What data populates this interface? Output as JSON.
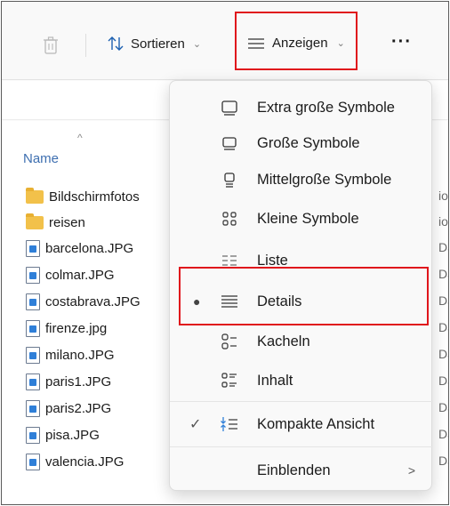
{
  "toolbar": {
    "delete_icon": "trash-icon",
    "sort_label": "Sortieren",
    "view_label": "Anzeigen",
    "more_label": "···"
  },
  "list": {
    "column_name": "Name",
    "files": [
      {
        "name": "Bildschirmfotos",
        "type": "folder",
        "right": "io"
      },
      {
        "name": "reisen",
        "type": "folder",
        "right": "io"
      },
      {
        "name": "barcelona.JPG",
        "type": "image",
        "right": "Da"
      },
      {
        "name": "colmar.JPG",
        "type": "image",
        "right": "Da"
      },
      {
        "name": "costabrava.JPG",
        "type": "image",
        "right": "Da"
      },
      {
        "name": "firenze.jpg",
        "type": "image",
        "right": "Da"
      },
      {
        "name": "milano.JPG",
        "type": "image",
        "right": "Da"
      },
      {
        "name": "paris1.JPG",
        "type": "image",
        "right": "Da"
      },
      {
        "name": "paris2.JPG",
        "type": "image",
        "right": "Da"
      },
      {
        "name": "pisa.JPG",
        "type": "image",
        "right": "Da"
      },
      {
        "name": "valencia.JPG",
        "type": "image",
        "right": "Da"
      }
    ]
  },
  "view_menu": {
    "items": [
      {
        "label": "Extra große Symbole",
        "icon": "extra-large-icons-icon"
      },
      {
        "label": "Große Symbole",
        "icon": "large-icons-icon"
      },
      {
        "label": "Mittelgroße Symbole",
        "icon": "medium-icons-icon"
      },
      {
        "label": "Kleine Symbole",
        "icon": "small-icons-icon"
      },
      {
        "label": "Liste",
        "icon": "list-icon"
      },
      {
        "label": "Details",
        "icon": "details-icon",
        "selected": true
      },
      {
        "label": "Kacheln",
        "icon": "tiles-icon"
      },
      {
        "label": "Inhalt",
        "icon": "content-icon"
      },
      {
        "label": "Kompakte Ansicht",
        "icon": "compact-view-icon",
        "checked": true
      },
      {
        "label": "Einblenden",
        "has_submenu": true
      }
    ]
  },
  "colors": {
    "highlight_box": "#e0161c",
    "accent_blue": "#2f7fd8",
    "folder_yellow": "#f2c14a"
  }
}
